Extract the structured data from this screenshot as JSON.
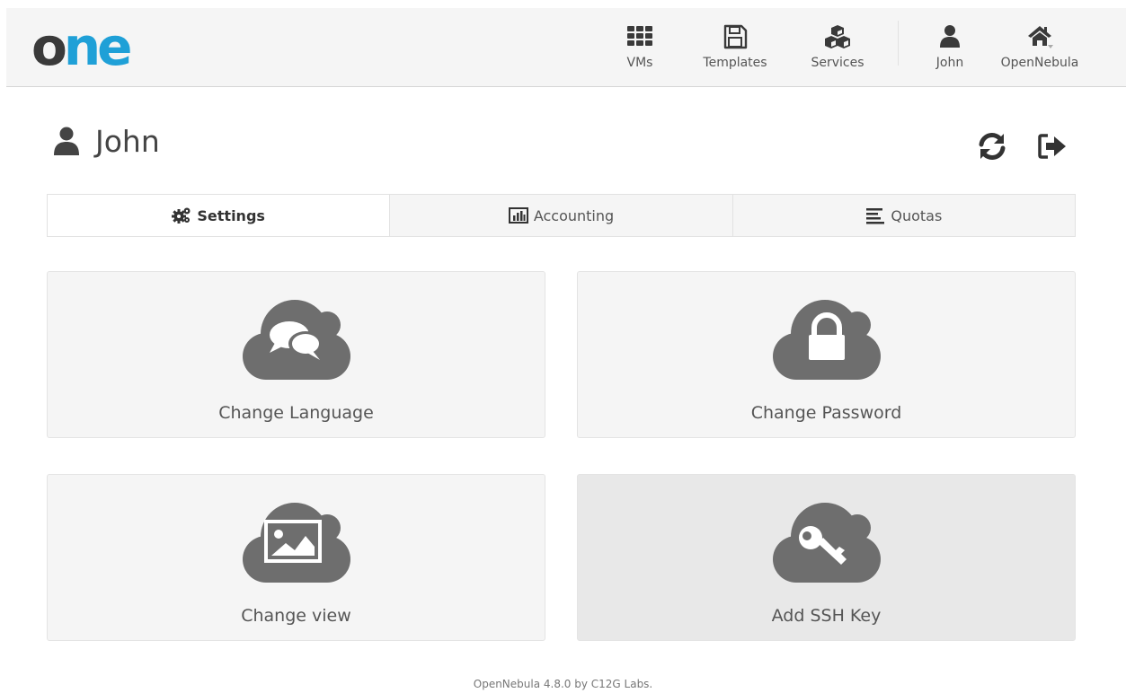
{
  "logo": {
    "part1": "o",
    "part2": "ne"
  },
  "nav": {
    "items": [
      {
        "label": "VMs",
        "icon": "grid-icon"
      },
      {
        "label": "Templates",
        "icon": "floppy-disk-icon"
      },
      {
        "label": "Services",
        "icon": "cubes-icon"
      },
      {
        "label": "John",
        "icon": "user-icon"
      },
      {
        "label": "OpenNebula",
        "icon": "home-icon"
      }
    ]
  },
  "page": {
    "title": "John"
  },
  "tabs": [
    {
      "label": "Settings",
      "icon": "gears-icon"
    },
    {
      "label": "Accounting",
      "icon": "bar-chart-icon"
    },
    {
      "label": "Quotas",
      "icon": "align-left-icon"
    }
  ],
  "cards": [
    {
      "label": "Change Language",
      "icon": "comments-icon"
    },
    {
      "label": "Change Password",
      "icon": "lock-icon"
    },
    {
      "label": "Change view",
      "icon": "picture-icon"
    },
    {
      "label": "Add SSH Key",
      "icon": "key-icon"
    }
  ],
  "footer": {
    "text": "OpenNebula 4.8.0 by C12G Labs."
  },
  "colors": {
    "accent": "#1fa0d7",
    "icon": "#6e6e6e",
    "dark": "#3a3a3a"
  }
}
